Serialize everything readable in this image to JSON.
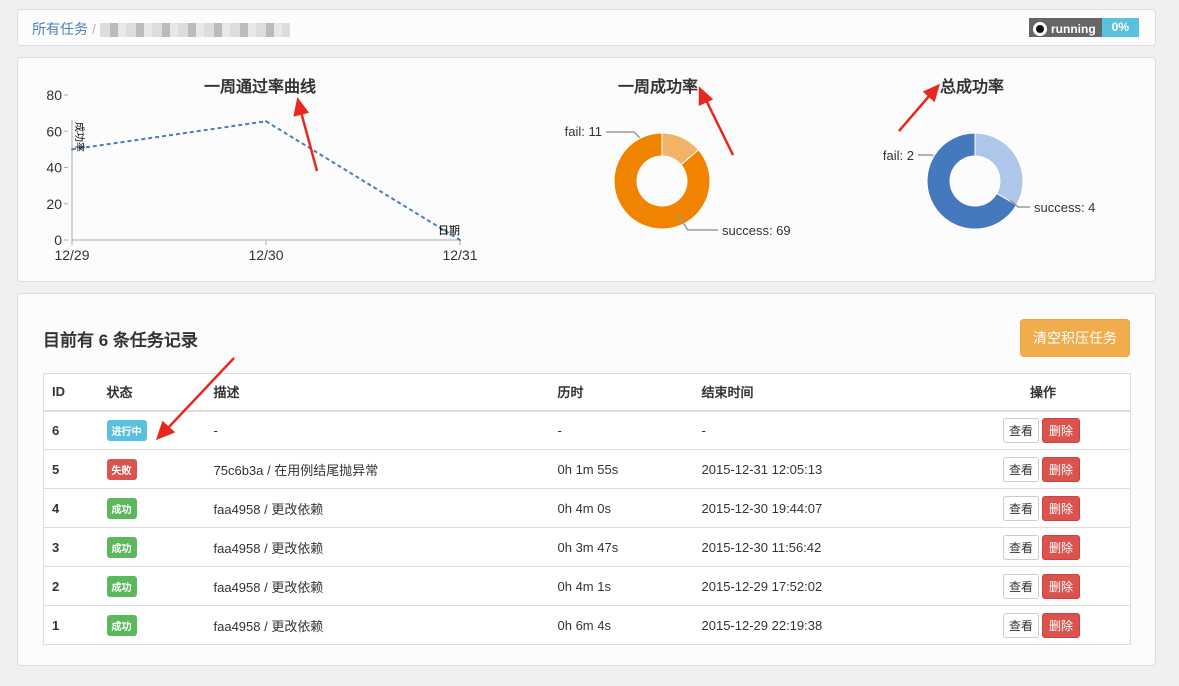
{
  "breadcrumb": {
    "root": "所有任务",
    "separator": "/"
  },
  "status": {
    "label": "running",
    "percent": "0%"
  },
  "charts_titles": {
    "line": "一周通过率曲线",
    "week": "一周成功率",
    "total": "总成功率"
  },
  "chart_data": [
    {
      "type": "line",
      "title": "一周通过率曲线",
      "xlabel": "日期",
      "ylabel": "成功率",
      "categories": [
        "12/29",
        "12/30",
        "12/31"
      ],
      "values": [
        50,
        65.5,
        0
      ],
      "ylim": [
        0,
        80
      ],
      "yticks": [
        "0",
        "20",
        "40",
        "60",
        "80"
      ],
      "color": "#4a7cc0"
    },
    {
      "type": "pie",
      "title": "一周成功率",
      "labels": [
        "fail: 11",
        "success: 69"
      ],
      "values": [
        11,
        69
      ],
      "colors": [
        "#f2b366",
        "#f08300"
      ]
    },
    {
      "type": "pie",
      "title": "总成功率",
      "labels": [
        "fail: 2",
        "success: 4"
      ],
      "values": [
        2,
        4
      ],
      "colors": [
        "#aec6ea",
        "#4479bd"
      ]
    }
  ],
  "tasks": {
    "heading": "目前有 6 条任务记录",
    "clear_button": "清空积压任务",
    "columns": [
      "ID",
      "状态",
      "描述",
      "历时",
      "结束时间",
      "操作"
    ],
    "view": "查看",
    "delete": "删除",
    "rows": [
      {
        "id": "6",
        "status": "进行中",
        "color": "#5bc0de",
        "desc": "-",
        "duration": "-",
        "end": "-"
      },
      {
        "id": "5",
        "status": "失败",
        "color": "#d9534f",
        "desc": "75c6b3a / 在用例结尾抛异常",
        "duration": "0h 1m 55s",
        "end": "2015-12-31 12:05:13"
      },
      {
        "id": "4",
        "status": "成功",
        "color": "#5cb85c",
        "desc": "faa4958 / 更改依赖",
        "duration": "0h 4m 0s",
        "end": "2015-12-30 19:44:07"
      },
      {
        "id": "3",
        "status": "成功",
        "color": "#5cb85c",
        "desc": "faa4958 / 更改依赖",
        "duration": "0h 3m 47s",
        "end": "2015-12-30 11:56:42"
      },
      {
        "id": "2",
        "status": "成功",
        "color": "#5cb85c",
        "desc": "faa4958 / 更改依赖",
        "duration": "0h 4m 1s",
        "end": "2015-12-29 17:52:02"
      },
      {
        "id": "1",
        "status": "成功",
        "color": "#5cb85c",
        "desc": "faa4958 / 更改依赖",
        "duration": "0h 6m 4s",
        "end": "2015-12-29 22:19:38"
      }
    ]
  }
}
